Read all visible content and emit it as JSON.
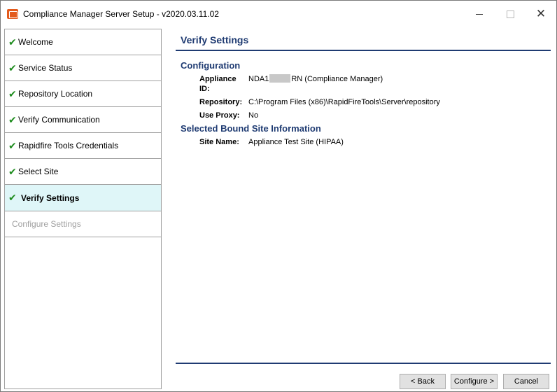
{
  "window": {
    "title": "Compliance Manager Server Setup - v2020.03.11.02",
    "icon": "app-window-icon"
  },
  "sidebar": {
    "steps": [
      {
        "label": "Welcome",
        "state": "done"
      },
      {
        "label": "Service Status",
        "state": "done"
      },
      {
        "label": "Repository Location",
        "state": "done"
      },
      {
        "label": "Verify Communication",
        "state": "done"
      },
      {
        "label": "Rapidfire Tools Credentials",
        "state": "done"
      },
      {
        "label": "Select Site",
        "state": "done"
      },
      {
        "label": "Verify Settings",
        "state": "active"
      },
      {
        "label": "Configure Settings",
        "state": "disabled"
      }
    ],
    "check_glyph": "✔"
  },
  "main": {
    "page_title": "Verify Settings",
    "configuration": {
      "title": "Configuration",
      "appliance_label": "Appliance ID:",
      "appliance_prefix": "NDA1",
      "appliance_suffix": "RN (Compliance Manager)",
      "repository_label": "Repository:",
      "repository_value": "C:\\Program Files (x86)\\RapidFireTools\\Server\\repository",
      "proxy_label": "Use Proxy:",
      "proxy_value": "No"
    },
    "site": {
      "title": "Selected Bound Site Information",
      "name_label": "Site Name:",
      "name_value": "Appliance Test Site (HIPAA)"
    }
  },
  "footer": {
    "back_label": "< Back",
    "configure_label": "Configure >",
    "cancel_label": "Cancel"
  },
  "colors": {
    "accent": "#1f3b72",
    "active_step_bg": "#dff6f8",
    "check": "#1e8c1e",
    "disabled_text": "#a0a0a0"
  }
}
